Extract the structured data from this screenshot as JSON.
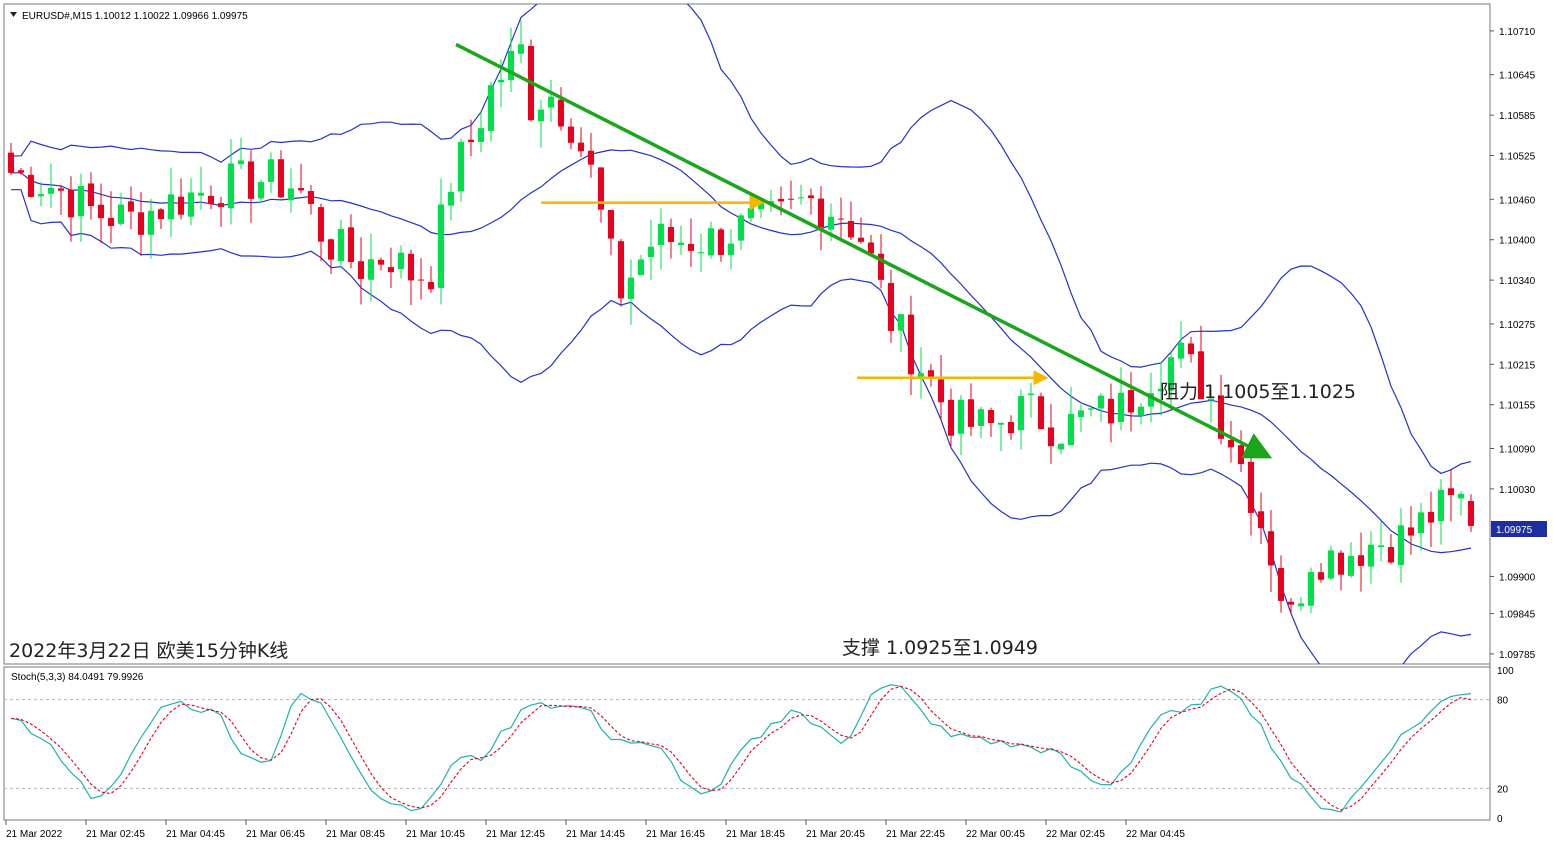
{
  "header": {
    "symbol_line": "EURUSD#,M15  1.10012 1.10022 1.09966 1.09975",
    "indicator_line": "Stoch(5,3,3) 84.0491 79.9926"
  },
  "annotations": {
    "resistance": "阻力 1.1005至1.1025",
    "support": "支撑 1.0925至1.0949",
    "caption": "2022年3月22日 欧美15分钟K线"
  },
  "colors": {
    "bull": "#00e04a",
    "bear": "#e8001c",
    "bands": "#2233cc",
    "trendline": "#1aa51a",
    "levels": "#f5b800",
    "stoch_main": "#20b2aa",
    "stoch_signal": "#e8001c",
    "price_tag": "#1e2ea0"
  },
  "chart_data": [
    {
      "type": "candlestick",
      "title": "EURUSD#,M15",
      "ohlc_current": {
        "open": 1.10012,
        "high": 1.10022,
        "low": 1.09966,
        "close": 1.09975
      },
      "current_price_label": "1.09975",
      "y_ticks": [
        "1.10710",
        "1.10645",
        "1.10585",
        "1.10525",
        "1.10460",
        "1.10400",
        "1.10340",
        "1.10275",
        "1.10215",
        "1.10155",
        "1.10090",
        "1.10030",
        "1.09975",
        "1.09900",
        "1.09845",
        "1.09785"
      ],
      "x_ticks": [
        "21 Mar 2022",
        "21 Mar 02:45",
        "21 Mar 04:45",
        "21 Mar 06:45",
        "21 Mar 08:45",
        "21 Mar 10:45",
        "21 Mar 12:45",
        "21 Mar 14:45",
        "21 Mar 16:45",
        "21 Mar 18:45",
        "21 Mar 20:45",
        "21 Mar 22:45",
        "22 Mar 00:45",
        "22 Mar 02:45",
        "22 Mar 04:45"
      ],
      "ylim": [
        1.0977,
        1.1075
      ],
      "grid": false,
      "bollinger_bands": true,
      "trendline": {
        "from_price": 1.1069,
        "to_price": 1.1008
      },
      "horizontal_levels": [
        {
          "price": 1.10455,
          "from": "21 Mar 13:00",
          "to": "21 Mar 18:30"
        },
        {
          "price": 1.10195,
          "from": "21 Mar 21:00",
          "to": "22 Mar 01:30"
        }
      ]
    },
    {
      "type": "line",
      "title": "Stoch(5,3,3)",
      "series": [
        {
          "name": "Stoch main",
          "last": 84.0491
        },
        {
          "name": "Stoch signal",
          "last": 79.9926
        }
      ],
      "y_ticks": [
        "100",
        "80",
        "20",
        "0"
      ],
      "levels": [
        80,
        20
      ],
      "ylim": [
        0,
        100
      ]
    }
  ]
}
